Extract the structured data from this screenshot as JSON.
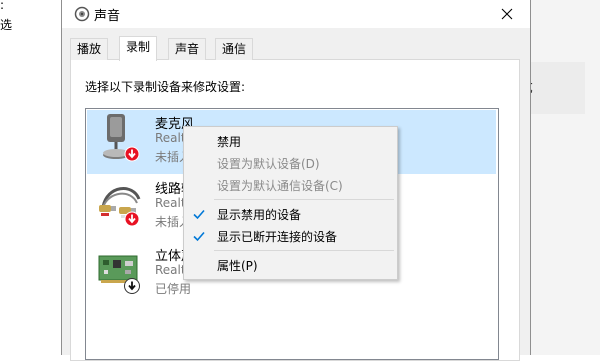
{
  "background": {
    "left_fragment_1": ":",
    "left_fragment_2": "选",
    "right_fragment": "t优"
  },
  "window": {
    "title": "声音",
    "title_icon": "speaker-icon",
    "close_icon": "close-icon"
  },
  "tabs": [
    {
      "label": "播放",
      "active": false
    },
    {
      "label": "录制",
      "active": true
    },
    {
      "label": "声音",
      "active": false
    },
    {
      "label": "通信",
      "active": false
    }
  ],
  "instruction": "选择以下录制设备来修改设置:",
  "devices": [
    {
      "name": "麦克风",
      "sub1": "Realt",
      "sub2": "未插入",
      "icon": "microphone-icon",
      "status_icon": "disconnected-red-arrow-icon",
      "selected": true
    },
    {
      "name": "线路输",
      "sub1": "Realt",
      "sub2": "未插入",
      "icon": "line-in-cable-icon",
      "status_icon": "disconnected-red-arrow-icon",
      "selected": false
    },
    {
      "name": "立体声",
      "sub1": "Realt",
      "sub2": "已停用",
      "icon": "sound-card-icon",
      "status_icon": "disabled-black-arrow-icon",
      "selected": false
    }
  ],
  "context_menu": {
    "items": [
      {
        "label": "禁用",
        "enabled": true,
        "checked": false
      },
      {
        "label": "设置为默认设备(D)",
        "enabled": false,
        "checked": false
      },
      {
        "label": "设置为默认通信设备(C)",
        "enabled": false,
        "checked": false
      },
      {
        "label": "显示禁用的设备",
        "enabled": true,
        "checked": true
      },
      {
        "label": "显示已断开连接的设备",
        "enabled": true,
        "checked": true
      },
      {
        "label": "属性(P)",
        "enabled": true,
        "checked": false
      }
    ],
    "check_icon": "checkmark-icon",
    "accent_color": "#0078d7"
  },
  "colors": {
    "selection": "#cce8ff",
    "disconnected_badge": "#e81123"
  }
}
